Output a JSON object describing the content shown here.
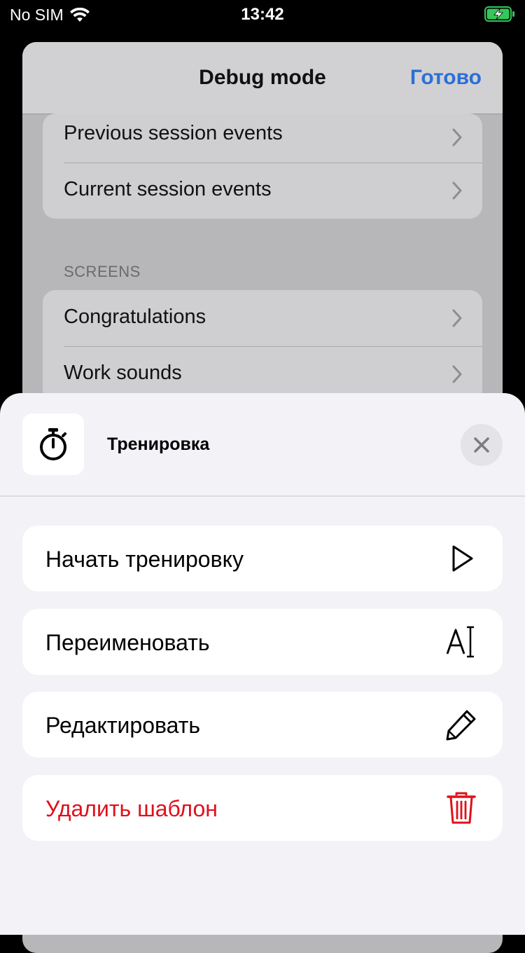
{
  "status_bar": {
    "carrier": "No SIM",
    "time": "13:42"
  },
  "debug_screen": {
    "title": "Debug mode",
    "done_label": "Готово",
    "events_group": [
      {
        "label": "Previous session events"
      },
      {
        "label": "Current session events"
      }
    ],
    "screens_header": "SCREENS",
    "screens_group": [
      {
        "label": "Congratulations"
      },
      {
        "label": "Work sounds"
      }
    ]
  },
  "action_sheet": {
    "title": "Тренировка",
    "icon": "stopwatch-icon",
    "actions": [
      {
        "label": "Начать тренировку",
        "icon": "play-icon"
      },
      {
        "label": "Переименовать",
        "icon": "rename-text-icon"
      },
      {
        "label": "Редактировать",
        "icon": "pencil-icon"
      },
      {
        "label": "Удалить шаблон",
        "icon": "trash-icon",
        "color": "#e0101c"
      }
    ]
  },
  "colors": {
    "accent": "#2b6fd6",
    "destructive": "#e0101c",
    "battery_charging": "#34c759"
  }
}
